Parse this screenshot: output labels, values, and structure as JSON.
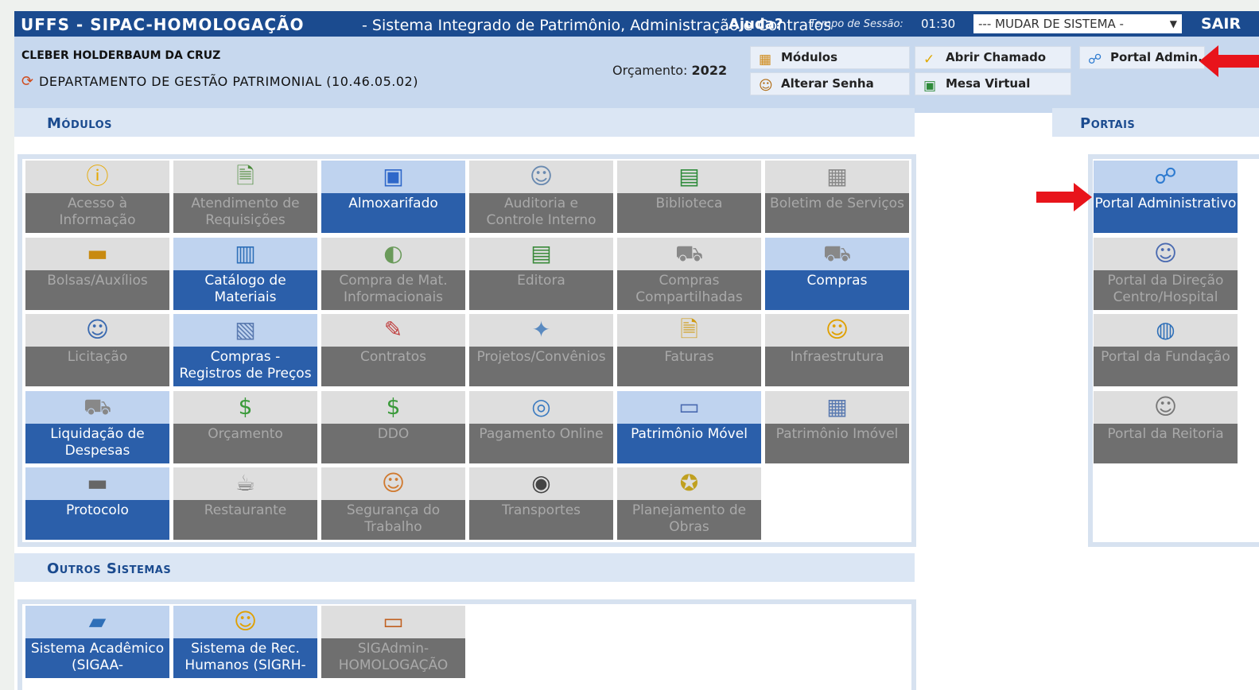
{
  "topbar": {
    "brand": "UFFS - SIPAC-HOMOLOGAÇÃO",
    "subtitle": "- Sistema Integrado de Patrimônio, Administração e Contratos",
    "help": "Ajuda?",
    "session_label": "Tempo de Sessão:",
    "session_time": "01:30",
    "system_select": "--- MUDAR DE SISTEMA -",
    "logout": "SAIR"
  },
  "info": {
    "user": "CLEBER HOLDERBAUM DA CRUZ",
    "department": "DEPARTAMENTO DE GESTÃO PATRIMONIAL (10.46.05.02)",
    "budget_label": "Orçamento:",
    "budget_year": "2022",
    "quick": [
      {
        "label": "Módulos",
        "icon": "modules-icon"
      },
      {
        "label": "Abrir Chamado",
        "icon": "ticket-icon"
      },
      {
        "label": "Portal Admin.",
        "icon": "portal-admin-icon"
      },
      {
        "label": "Alterar Senha",
        "icon": "key-user-icon"
      },
      {
        "label": "Mesa Virtual",
        "icon": "virtual-desk-icon"
      }
    ]
  },
  "sections": {
    "modulos": "Módulos",
    "portais": "Portais",
    "outros": "Outros Sistemas"
  },
  "modules": [
    {
      "label": "Acesso à\nInformação",
      "active": false,
      "icon": "info-icon"
    },
    {
      "label": "Atendimento de\nRequisições",
      "active": false,
      "icon": "document-check-icon"
    },
    {
      "label": "Almoxarifado",
      "active": true,
      "icon": "boxes-icon"
    },
    {
      "label": "Auditoria e\nControle Interno",
      "active": false,
      "icon": "auditor-icon"
    },
    {
      "label": "Biblioteca",
      "active": false,
      "icon": "books-icon"
    },
    {
      "label": "Boletim de Serviços",
      "active": false,
      "icon": "bulletin-icon"
    },
    {
      "label": "Bolsas/Auxílios",
      "active": false,
      "icon": "wallet-icon"
    },
    {
      "label": "Catálogo de\nMateriais",
      "active": true,
      "icon": "catalog-icon"
    },
    {
      "label": "Compra de Mat.\nInformacionais",
      "active": false,
      "icon": "media-purchase-icon"
    },
    {
      "label": "Editora",
      "active": false,
      "icon": "publisher-icon"
    },
    {
      "label": "Compras\nCompartilhadas",
      "active": false,
      "icon": "shared-cart-icon"
    },
    {
      "label": "Compras",
      "active": true,
      "icon": "cart-icon"
    },
    {
      "label": "Licitação",
      "active": false,
      "icon": "bidding-icon"
    },
    {
      "label": "Compras -\nRegistros de Preços",
      "active": true,
      "icon": "calculator-icon"
    },
    {
      "label": "Contratos",
      "active": false,
      "icon": "contract-icon"
    },
    {
      "label": "Projetos/Convênios",
      "active": false,
      "icon": "projects-icon"
    },
    {
      "label": "Faturas",
      "active": false,
      "icon": "invoice-icon"
    },
    {
      "label": "Infraestrutura",
      "active": false,
      "icon": "worker-icon"
    },
    {
      "label": "Liquidação de\nDespesas",
      "active": true,
      "icon": "cart-pay-icon"
    },
    {
      "label": "Orçamento",
      "active": false,
      "icon": "money-icon"
    },
    {
      "label": "DDO",
      "active": false,
      "icon": "money-stack-icon"
    },
    {
      "label": "Pagamento Online",
      "active": false,
      "icon": "online-payment-icon"
    },
    {
      "label": "Patrimônio Móvel",
      "active": true,
      "icon": "computer-icon"
    },
    {
      "label": "Patrimônio Imóvel",
      "active": false,
      "icon": "building-icon"
    },
    {
      "label": "Protocolo",
      "active": true,
      "icon": "book-icon"
    },
    {
      "label": "Restaurante",
      "active": false,
      "icon": "cup-icon"
    },
    {
      "label": "Segurança do\nTrabalho",
      "active": false,
      "icon": "helmet-icon"
    },
    {
      "label": "Transportes",
      "active": false,
      "icon": "tire-icon"
    },
    {
      "label": "Planejamento de\nObras",
      "active": false,
      "icon": "construction-icon"
    }
  ],
  "portals": [
    {
      "label": "Portal Administrativo",
      "active": true,
      "icon": "portal-admin-icon"
    },
    {
      "label": "Portal da Direção\nCentro/Hospital",
      "active": false,
      "icon": "director-icon"
    },
    {
      "label": "Portal da Fundação",
      "active": false,
      "icon": "globe-icon"
    },
    {
      "label": "Portal da Reitoria",
      "active": false,
      "icon": "rector-icon"
    }
  ],
  "other_systems": [
    {
      "label": "Sistema Acadêmico\n(SIGAA-",
      "active": true,
      "icon": "academic-book-icon"
    },
    {
      "label": "Sistema de Rec.\nHumanos (SIGRH-",
      "active": true,
      "icon": "person-icon"
    },
    {
      "label": "SIGAdmin-\nHOMOLOGAÇÃO",
      "active": false,
      "icon": "admin-computer-icon"
    }
  ],
  "colors": {
    "topbar": "#1b4b8f",
    "active_tile": "#2b5faa",
    "inactive_tile": "#6f6f6f",
    "arrow": "#e8141b"
  }
}
